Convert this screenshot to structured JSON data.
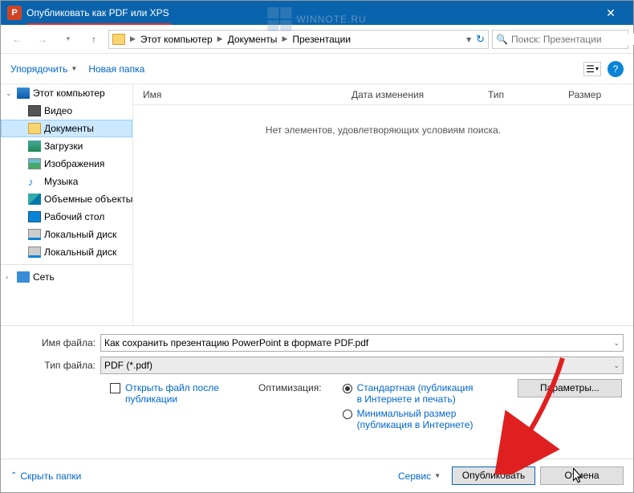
{
  "titlebar": {
    "title": "Опубликовать как PDF или XPS"
  },
  "nav": {
    "breadcrumb": [
      "Этот компьютер",
      "Документы",
      "Презентации"
    ],
    "search_placeholder": "Поиск: Презентации"
  },
  "toolbar": {
    "organize": "Упорядочить",
    "new_folder": "Новая папка"
  },
  "tree": {
    "this_pc": "Этот компьютер",
    "video": "Видео",
    "documents": "Документы",
    "downloads": "Загрузки",
    "images": "Изображения",
    "music": "Музыка",
    "objects3d": "Объемные объекты",
    "desktop": "Рабочий стол",
    "localdisk1": "Локальный диск",
    "localdisk2": "Локальный диск",
    "network": "Сеть"
  },
  "columns": {
    "name": "Имя",
    "date": "Дата изменения",
    "type": "Тип",
    "size": "Размер"
  },
  "empty": "Нет элементов, удовлетворяющих условиям поиска.",
  "form": {
    "filename_label": "Имя файла:",
    "filename_value": "Как сохранить презентацию PowerPoint в формате PDF.pdf",
    "filetype_label": "Тип файла:",
    "filetype_value": "PDF (*.pdf)",
    "open_after": "Открыть файл после публикации",
    "optimization": "Оптимизация:",
    "opt_standard": "Стандартная (публикация в Интернете и печать)",
    "opt_minimal": "Минимальный размер (публикация в Интернете)",
    "params": "Параметры..."
  },
  "footer": {
    "hide_folders": "Скрыть папки",
    "service": "Сервис",
    "publish": "Опубликовать",
    "cancel": "Отмена"
  },
  "watermark": "WINNOTE.RU"
}
